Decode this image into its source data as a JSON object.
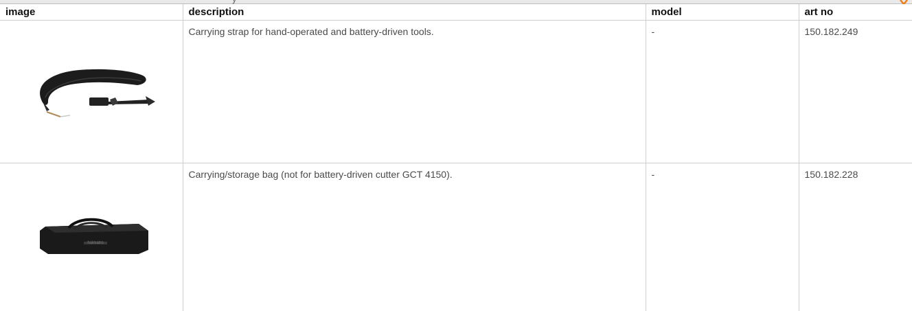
{
  "table": {
    "headers": {
      "image": "image",
      "description": "description",
      "model": "model",
      "art_no": "art no"
    },
    "rows": [
      {
        "image_icon": "carrying-strap-photo",
        "description": "Carrying strap for hand-operated and battery-driven tools.",
        "model": "-",
        "art_no": "150.182.249"
      },
      {
        "image_icon": "storage-bag-photo",
        "description": "Carrying/storage bag (not for battery-driven cutter GCT 4150).",
        "model": "-",
        "art_no": "150.182.228",
        "bag_logo": "holmatro"
      }
    ]
  },
  "colors": {
    "accent": "#f07d1a",
    "grid": "#cfcfcf",
    "header_bar": "#e9e9e9"
  }
}
